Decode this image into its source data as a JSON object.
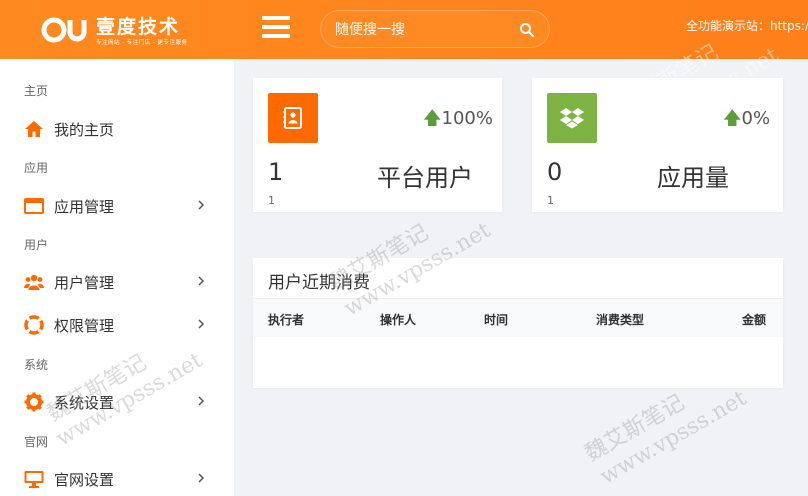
{
  "header": {
    "logo_title": "壹度技术",
    "logo_sub": "专注网站 · 专注门店 · 更专注服务",
    "search_placeholder": "随便搜一搜",
    "right_text": "全功能演示站：https://",
    "brand_color": "#ff7f1a"
  },
  "sidebar": {
    "groups": [
      {
        "title": "主页",
        "items": [
          {
            "label": "我的主页",
            "icon": "home-icon",
            "has_arrow": false
          }
        ]
      },
      {
        "title": "应用",
        "items": [
          {
            "label": "应用管理",
            "icon": "window-icon",
            "has_arrow": true
          }
        ]
      },
      {
        "title": "用户",
        "items": [
          {
            "label": "用户管理",
            "icon": "users-icon",
            "has_arrow": true
          },
          {
            "label": "权限管理",
            "icon": "lifebuoy-icon",
            "has_arrow": true
          }
        ]
      },
      {
        "title": "系统",
        "items": [
          {
            "label": "系统设置",
            "icon": "gear-icon",
            "has_arrow": true
          }
        ]
      },
      {
        "title": "官网",
        "items": [
          {
            "label": "官网设置",
            "icon": "monitor-icon",
            "has_arrow": true
          }
        ]
      }
    ]
  },
  "stats": [
    {
      "icon": "contact-book-icon",
      "icon_color": "#ff6a00",
      "trend": "100%",
      "value": "1",
      "name": "平台用户",
      "foot": "1"
    },
    {
      "icon": "dropbox-icon",
      "icon_color": "#7cb342",
      "trend": "0%",
      "value": "0",
      "name": "应用量",
      "foot": "1"
    }
  ],
  "table": {
    "title": "用户近期消费",
    "columns": [
      "执行者",
      "操作人",
      "时间",
      "消费类型",
      "金额"
    ]
  },
  "watermark": {
    "cn": "魏艾斯笔记",
    "url": "www.vpsss.net"
  }
}
